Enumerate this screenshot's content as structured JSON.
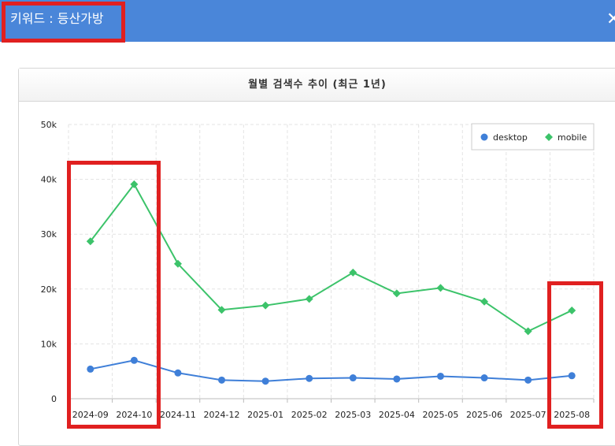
{
  "header": {
    "title": "키워드 : 등산가방",
    "close_glyph": "✕",
    "background": "#4a86d9"
  },
  "card": {
    "title": "월별 검색수 추이 (최근 1년)"
  },
  "chart_data": {
    "type": "line",
    "categories": [
      "2024-09",
      "2024-10",
      "2024-11",
      "2024-12",
      "2025-01",
      "2025-02",
      "2025-03",
      "2025-04",
      "2025-05",
      "2025-06",
      "2025-07",
      "2025-08"
    ],
    "y_ticks": [
      "0",
      "10k",
      "20k",
      "30k",
      "40k",
      "50k"
    ],
    "ylim": [
      0,
      50000
    ],
    "grid": true,
    "legend_position": "top-right",
    "series": [
      {
        "name": "desktop",
        "color": "#3f7fd8",
        "marker": "circle",
        "values": [
          5400,
          7000,
          4700,
          3400,
          3200,
          3700,
          3800,
          3600,
          4100,
          3800,
          3400,
          4200
        ]
      },
      {
        "name": "mobile",
        "color": "#3cc36a",
        "marker": "diamond",
        "values": [
          28700,
          39100,
          24600,
          16200,
          17000,
          18200,
          23000,
          19200,
          20200,
          17700,
          12300,
          16100
        ]
      }
    ]
  },
  "annotation_color": "#e02020"
}
